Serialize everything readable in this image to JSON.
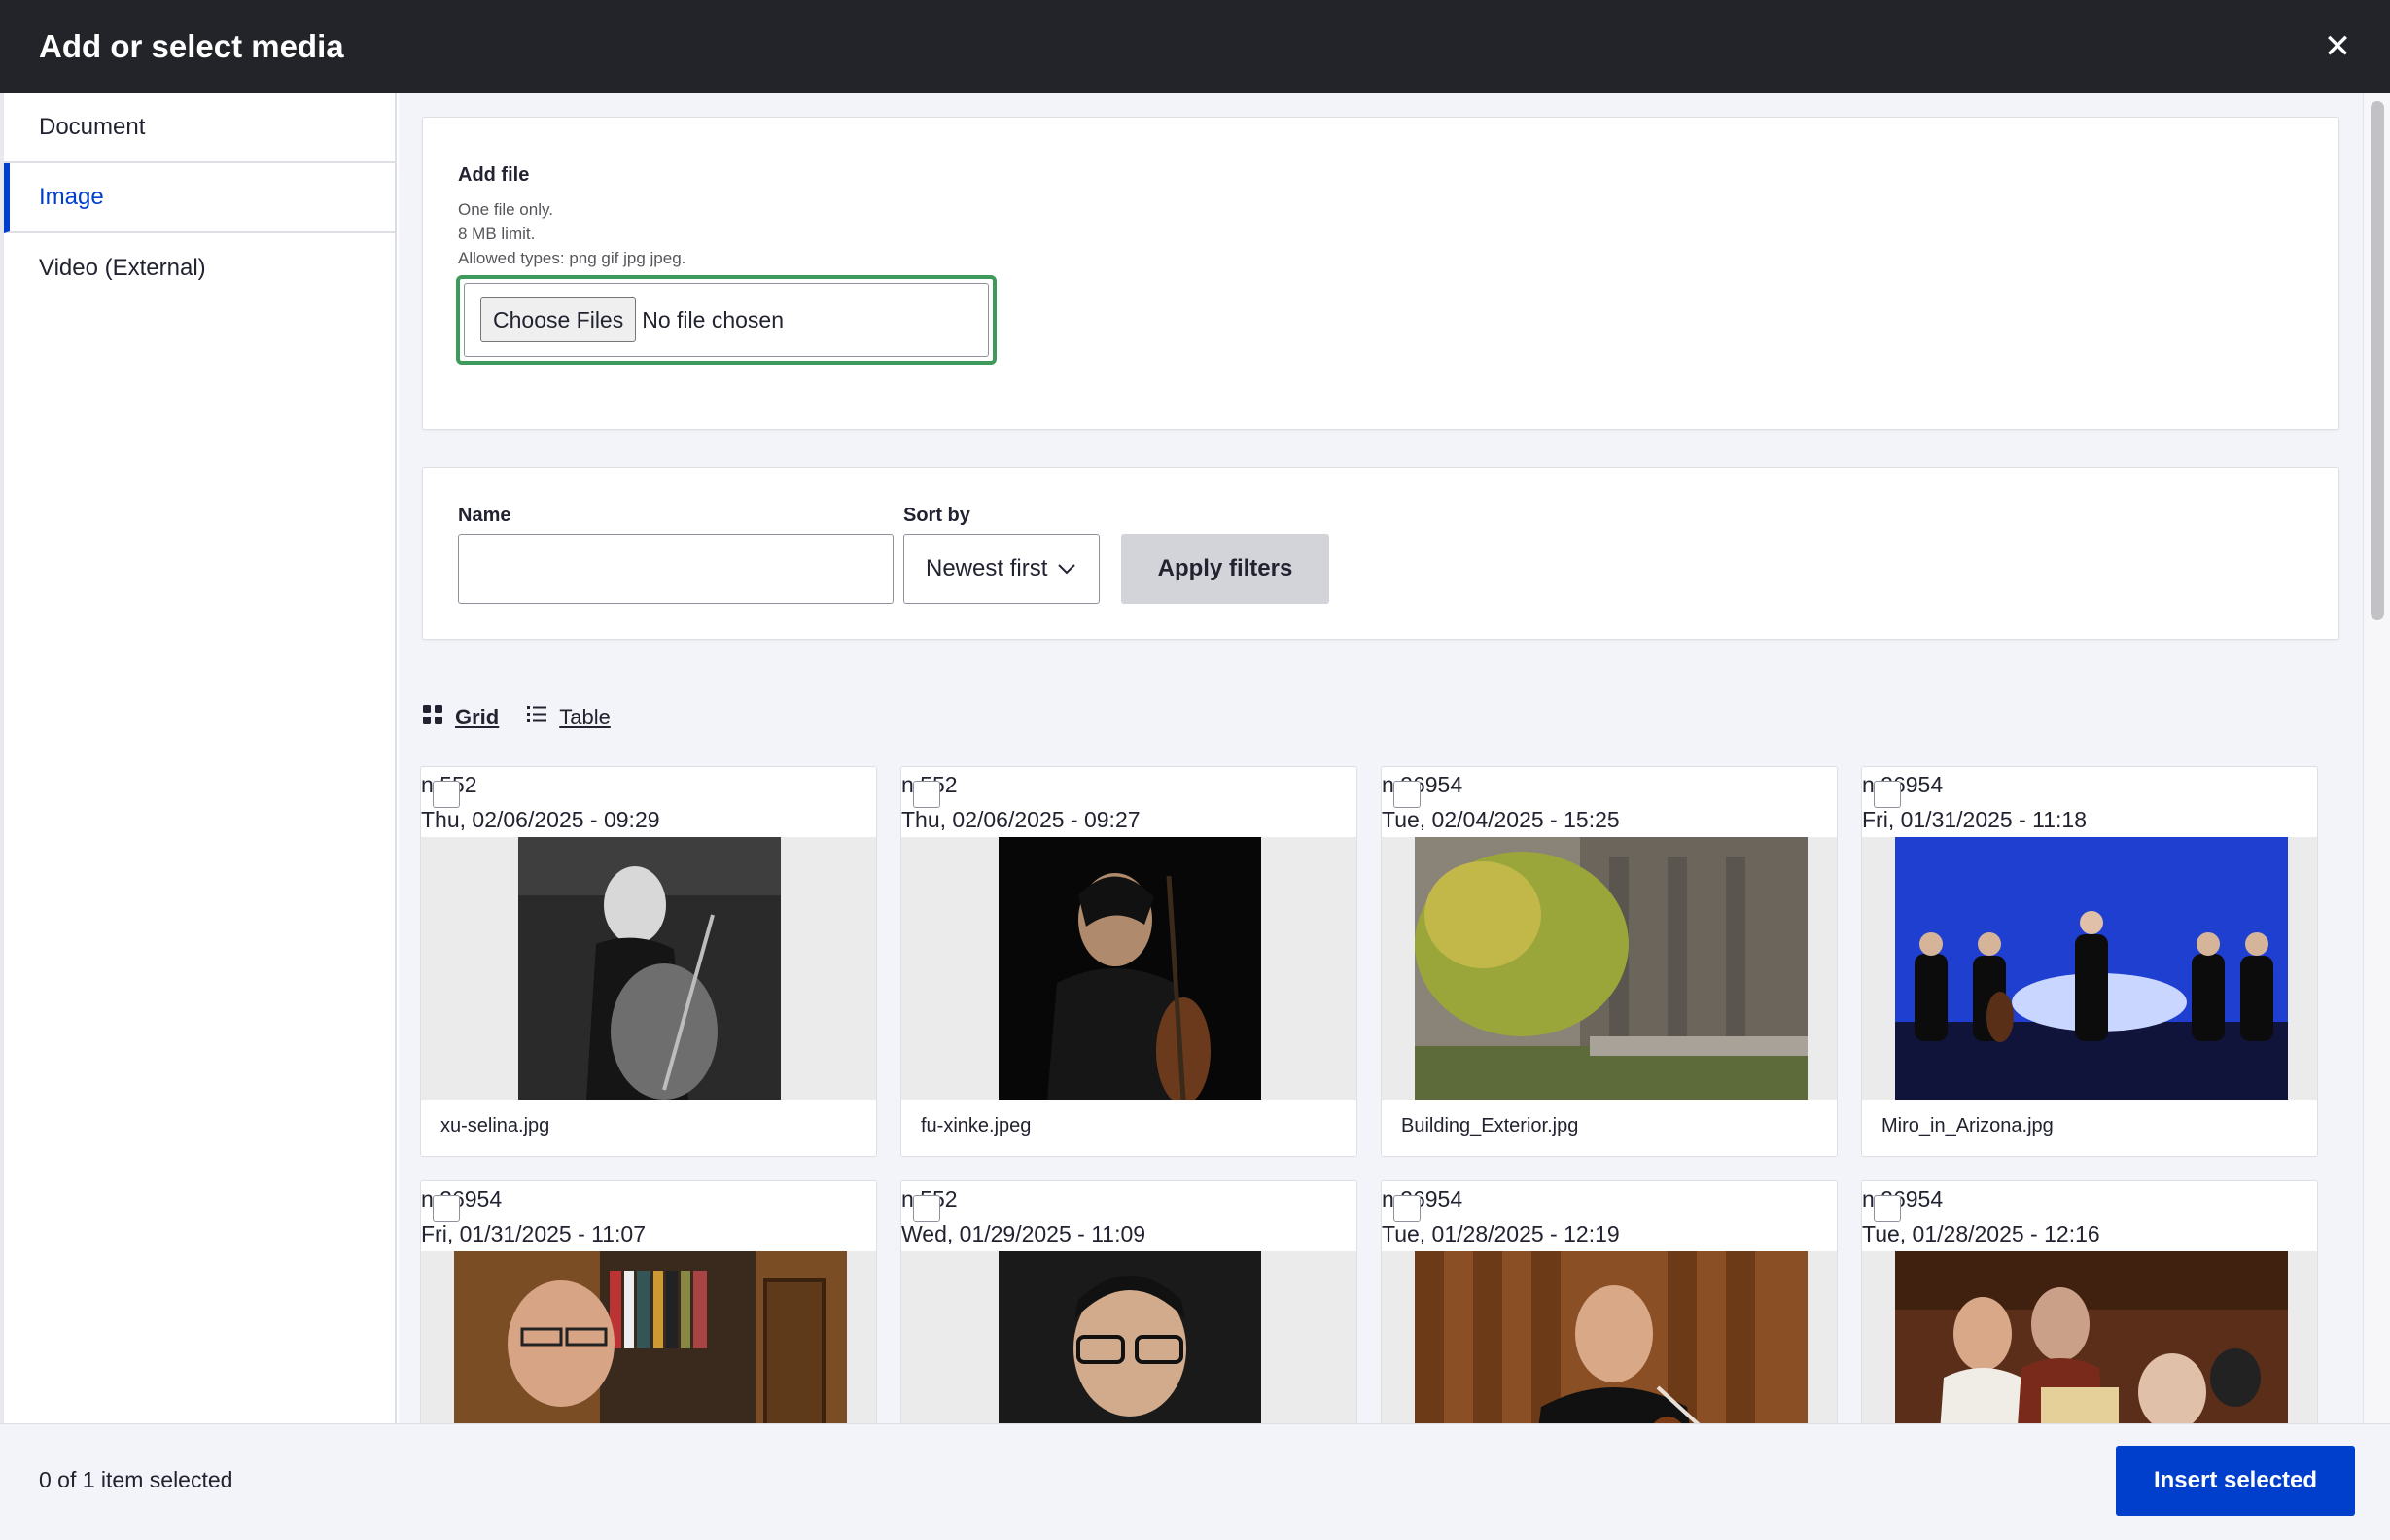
{
  "dialog": {
    "title": "Add or select media",
    "close_icon": "close-icon"
  },
  "sidebar": {
    "tabs": [
      {
        "label": "Document",
        "active": false
      },
      {
        "label": "Image",
        "active": true
      },
      {
        "label": "Video (External)",
        "active": false
      }
    ]
  },
  "upload": {
    "heading": "Add file",
    "help": [
      "One file only.",
      "8 MB limit.",
      "Allowed types: png gif jpg jpeg."
    ],
    "choose_label": "Choose Files",
    "no_file": "No file chosen"
  },
  "filters": {
    "name_label": "Name",
    "name_value": "",
    "sort_label": "Sort by",
    "sort_value": "Newest first",
    "apply_label": "Apply filters"
  },
  "view": {
    "grid_label": "Grid",
    "table_label": "Table",
    "active": "Grid"
  },
  "media": [
    {
      "author": "n 552",
      "date": "Thu, 02/06/2025 - 09:29",
      "filename": "xu-selina.jpg"
    },
    {
      "author": "n 552",
      "date": "Thu, 02/06/2025 - 09:27",
      "filename": "fu-xinke.jpeg"
    },
    {
      "author": "n 26954",
      "date": "Tue, 02/04/2025 - 15:25",
      "filename": "Building_Exterior.jpg"
    },
    {
      "author": "n 26954",
      "date": "Fri, 01/31/2025 - 11:18",
      "filename": "Miro_in_Arizona.jpg"
    },
    {
      "author": "n 26954",
      "date": "Fri, 01/31/2025 - 11:07",
      "filename": ""
    },
    {
      "author": "n 552",
      "date": "Wed, 01/29/2025 - 11:09",
      "filename": ""
    },
    {
      "author": "n 26954",
      "date": "Tue, 01/28/2025 - 12:19",
      "filename": ""
    },
    {
      "author": "n 26954",
      "date": "Tue, 01/28/2025 - 12:16",
      "filename": ""
    }
  ],
  "footer": {
    "status": "0 of 1 item selected",
    "insert_label": "Insert selected"
  },
  "colors": {
    "accent": "#003ecc",
    "titlebar": "#232429",
    "focus": "#3d9a5a"
  }
}
